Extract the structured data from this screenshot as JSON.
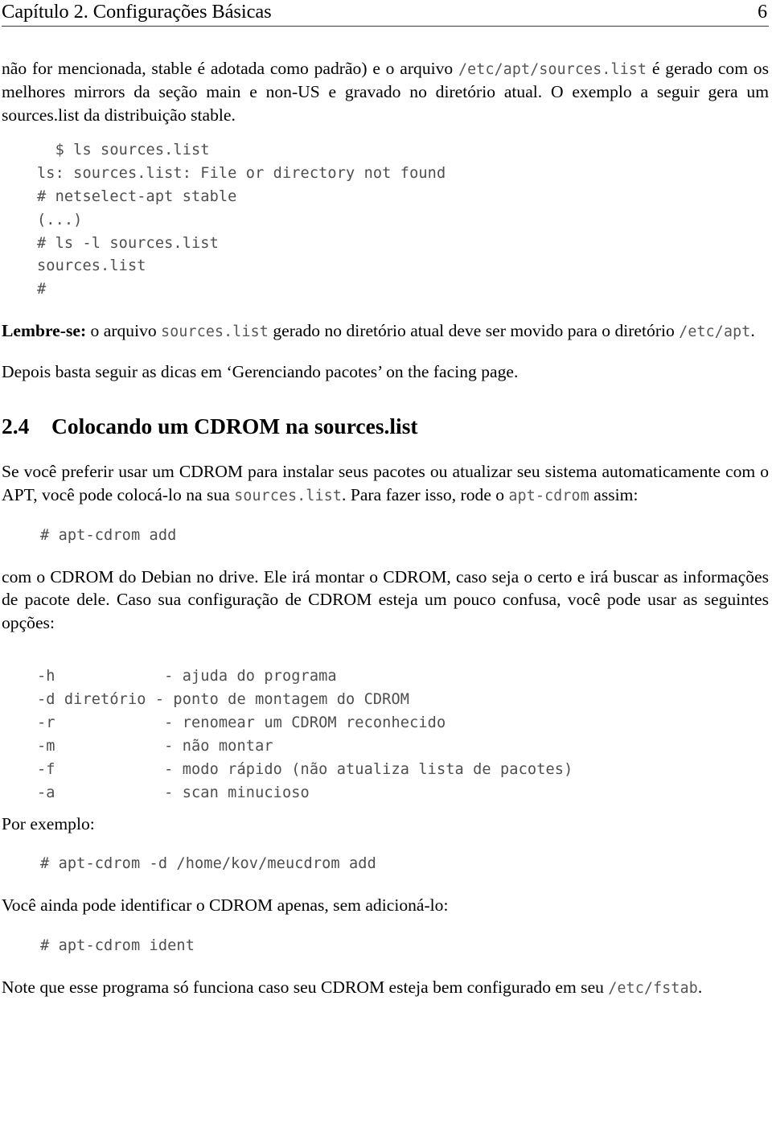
{
  "header": {
    "title": "Capítulo 2. Configurações Básicas",
    "page_number": "6"
  },
  "intro_paragraph": {
    "part1": "não for mencionada, stable é adotada como padrão) e o arquivo ",
    "code1": "/etc/apt/sources.list",
    "part2": " é gerado com os melhores mirrors da seção main e non-US e gravado no diretório atual. O exemplo a seguir gera um sources.list da distribuição stable."
  },
  "code_block_1": "  $ ls sources.list\nls: sources.list: File or directory not found\n# netselect-apt stable\n(...)\n# ls -l sources.list\nsources.list\n#",
  "remember": {
    "label": "Lembre-se:",
    "part1": " o arquivo ",
    "code1": "sources.list",
    "part2": " gerado no diretório atual deve ser movido para o diretório ",
    "code2": "/etc/apt",
    "part3": "."
  },
  "tip_paragraph": "Depois basta seguir as dicas em ‘Gerenciando pacotes’ on the facing page.",
  "section": {
    "number": "2.4",
    "title": "Colocando um CDROM na sources.list"
  },
  "cdrom_paragraph": {
    "part1": "Se você preferir usar um CDROM para instalar seus pacotes ou atualizar seu sistema automaticamente com o APT, você pode colocá-lo na sua ",
    "code1": "sources.list",
    "part2": ". Para fazer isso, rode o ",
    "code2": "apt-cdrom",
    "part3": " assim:"
  },
  "code_block_2": "# apt-cdrom add",
  "drive_paragraph": "com o CDROM do Debian no drive. Ele irá montar o CDROM, caso seja o certo e irá buscar as informações de pacote dele. Caso sua configuração de CDROM esteja um pouco confusa, você pode usar as seguintes opções:",
  "options_block": "-h            - ajuda do programa\n-d diretório - ponto de montagem do CDROM\n-r            - renomear um CDROM reconhecido\n-m            - não montar\n-f            - modo rápido (não atualiza lista de pacotes)\n-a            - scan minucioso",
  "example_label": "Por exemplo:",
  "code_block_3": "# apt-cdrom -d /home/kov/meucdrom add",
  "ident_paragraph": "Você ainda pode identificar o CDROM apenas, sem adicioná-lo:",
  "code_block_4": "# apt-cdrom ident",
  "note_paragraph": {
    "part1": "Note que esse programa só funciona caso seu CDROM esteja bem configurado em seu ",
    "code1": "/etc/fstab",
    "part2": "."
  }
}
